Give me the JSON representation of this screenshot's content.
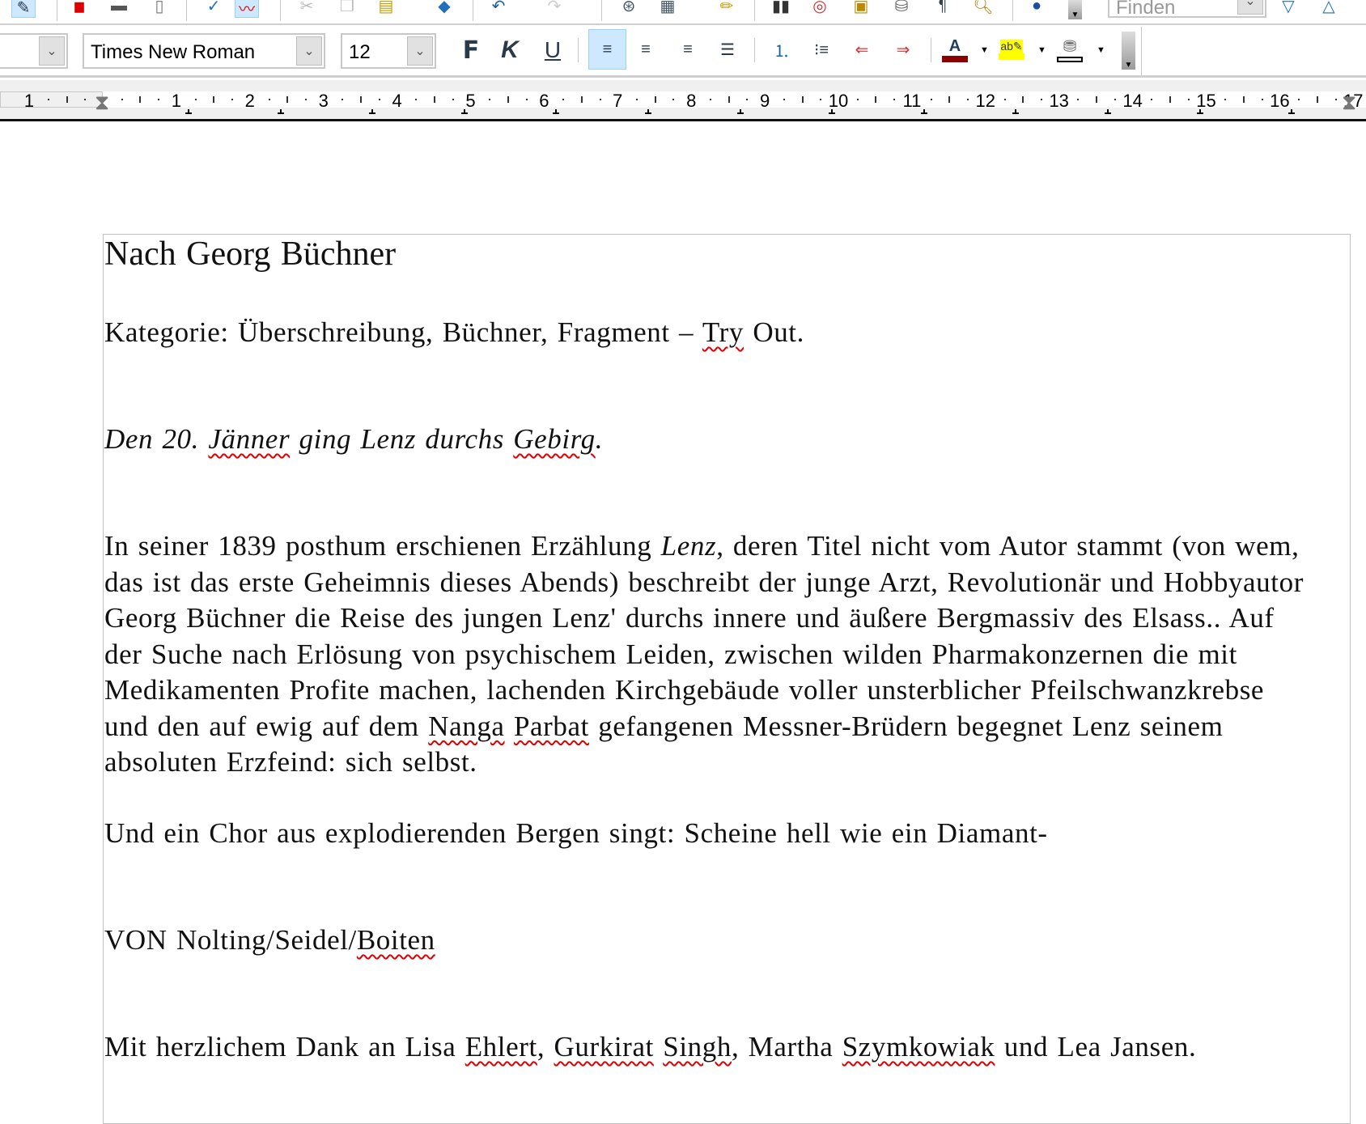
{
  "toolbar": {
    "find_placeholder": "Finden",
    "paragraph_style": "",
    "font_name": "Times New Roman",
    "font_size": "12",
    "bold_label": "F",
    "italic_label": "K",
    "underline_label": "U",
    "font_color": "#8b0000",
    "highlight_color": "#ffff00"
  },
  "ruler": {
    "left_label": "1",
    "labels": [
      "1",
      "2",
      "3",
      "4",
      "5",
      "6",
      "7",
      "8",
      "9",
      "10",
      "11",
      "12",
      "13",
      "14",
      "15",
      "16",
      "17"
    ]
  },
  "document": {
    "title": "Nach Georg Büchner",
    "paragraphs": [
      {
        "lines": [
          [
            {
              "t": "Kategorie: Überschreibung, Büchner, Fragment – "
            },
            {
              "t": "Try",
              "err": true
            },
            {
              "t": " Out."
            }
          ]
        ]
      },
      {
        "lines": [
          [
            {
              "t": "Den 20. ",
              "i": true
            },
            {
              "t": "Jänner",
              "i": true,
              "err": true
            },
            {
              "t": " ging Lenz durchs ",
              "i": true
            },
            {
              "t": "Gebirg",
              "i": true,
              "err": true
            },
            {
              "t": ".",
              "i": true
            }
          ]
        ]
      },
      {
        "lines": [
          [
            {
              "t": "In seiner 1839 posthum erschienen Erzählung "
            },
            {
              "t": "Lenz",
              "i": true
            },
            {
              "t": ", deren Titel nicht vom Autor stammt (von wem,"
            }
          ],
          [
            {
              "t": "das ist das erste Geheimnis dieses Abends) beschreibt der junge Arzt, Revolutionär und Hobbyautor"
            }
          ],
          [
            {
              "t": "Georg Büchner die Reise des jungen Lenz' durchs innere und äußere Bergmassiv des Elsass.. Auf"
            }
          ],
          [
            {
              "t": "der Suche nach Erlösung von psychischem Leiden, zwischen wilden Pharmakonzernen die mit"
            }
          ],
          [
            {
              "t": "Medikamenten Profite machen, lachenden Kirchgebäude voller unsterblicher Pfeilschwanzkrebse"
            }
          ],
          [
            {
              "t": "und den auf ewig auf dem "
            },
            {
              "t": "Nanga",
              "err": true
            },
            {
              "t": " "
            },
            {
              "t": "Parbat",
              "err": true
            },
            {
              "t": " gefangenen Messner-Brüdern begegnet Lenz seinem"
            }
          ],
          [
            {
              "t": "absoluten Erzfeind: sich selbst."
            }
          ]
        ]
      },
      {
        "lines": [
          [
            {
              "t": "Und ein Chor aus explodierenden Bergen singt: Scheine hell wie ein Diamant-"
            }
          ]
        ]
      },
      {
        "lines": [
          [
            {
              "t": "VON Nolting/Seidel/"
            },
            {
              "t": "Boiten",
              "err": true
            }
          ]
        ]
      },
      {
        "lines": [
          [
            {
              "t": "Mit herzlichem Dank an Lisa "
            },
            {
              "t": "Ehlert",
              "err": true
            },
            {
              "t": ", "
            },
            {
              "t": "Gurkirat",
              "err": true
            },
            {
              "t": " "
            },
            {
              "t": "Singh",
              "err": true
            },
            {
              "t": ", Martha "
            },
            {
              "t": "Szymkowiak",
              "err": true
            },
            {
              "t": " und Lea Jansen."
            }
          ]
        ]
      }
    ]
  }
}
